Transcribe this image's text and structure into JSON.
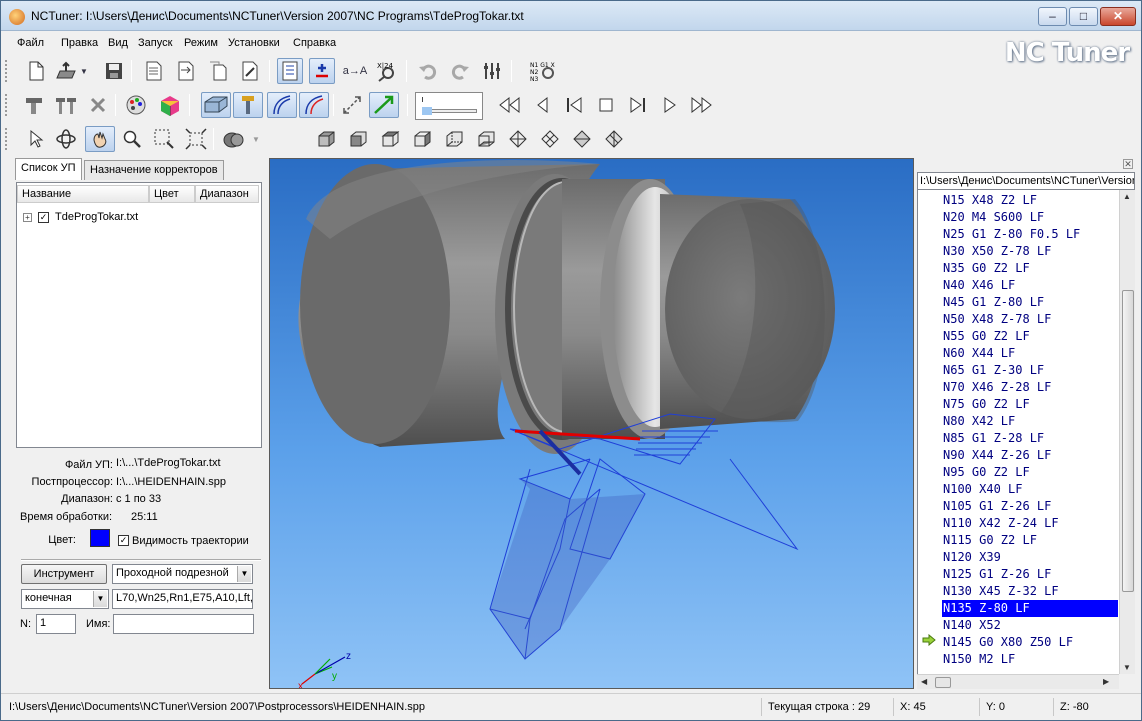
{
  "window": {
    "title": "NCTuner: I:\\Users\\Денис\\Documents\\NCTuner\\Version 2007\\NC Programs\\TdeProgTokar.txt",
    "min_glyph": "–",
    "max_glyph": "□",
    "close_glyph": "✕"
  },
  "menu": [
    "Файл",
    "Правка",
    "Вид",
    "Запуск",
    "Режим",
    "Установки",
    "Справка"
  ],
  "logo": "NC Tuner",
  "left_panel": {
    "tabs": [
      "Список УП",
      "Назначение корректоров"
    ],
    "columns": [
      "Название",
      "Цвет",
      "Диапазон"
    ],
    "program_name": "TdeProgTokar.txt",
    "program_checked": "✓",
    "info": {
      "file_label": "Файл УП:",
      "file_value": "I:\\...\\TdeProgTokar.txt",
      "pp_label": "Постпроцессор:",
      "pp_value": "I:\\...\\HEIDENHAIN.spp",
      "range_label": "Диапазон:",
      "range_value": "с 1  по 33",
      "time_label": "Время обработки:",
      "time_value": "25:11",
      "color_label": "Цвет:",
      "visibility_label": "Видимость траектории",
      "visibility_checked": "✓"
    },
    "tool_button": "Инструмент",
    "tool_combo": "Проходной подрезной",
    "mode_combo": "конечная",
    "tool_params": "L70,Wn25,Rn1,E75,A10,Lft,",
    "n_label": "N:",
    "n_value": "1",
    "name_label": "Имя:",
    "name_value": ""
  },
  "viewport": {
    "axes": {
      "x": "x",
      "y": "y",
      "z": "z"
    }
  },
  "code_panel": {
    "path": "I:\\Users\\Денис\\Documents\\NCTuner\\Version",
    "lines": [
      "N15 X48 Z2 LF",
      "N20 M4 S600 LF",
      "N25 G1 Z-80 F0.5 LF",
      "N30 X50 Z-78 LF",
      "N35 G0 Z2 LF",
      "N40 X46 LF",
      "N45 G1 Z-80 LF",
      "N50 X48 Z-78 LF",
      "N55 G0 Z2 LF",
      "N60 X44 LF",
      "N65 G1 Z-30 LF",
      "N70 X46 Z-28 LF",
      "N75 G0 Z2 LF",
      "N80 X42 LF",
      "N85 G1 Z-28 LF",
      "N90 X44 Z-26 LF",
      "N95 G0 Z2 LF",
      "N100 X40 LF",
      "N105 G1 Z-26 LF",
      "N110 X42 Z-24 LF",
      "N115 G0 Z2 LF",
      "N120 X39",
      "N125 G1 Z-26 LF",
      "N130 X45 Z-32 LF",
      "N135 Z-80 LF",
      "N140 X52",
      "N145 G0 X80 Z50 LF",
      "N150 M2 LF"
    ],
    "current_index": 24
  },
  "status": {
    "path": "I:\\Users\\Денис\\Documents\\NCTuner\\Version 2007\\Postprocessors\\HEIDENHAIN.spp",
    "current_line": "Текущая строка : 29",
    "x": "X: 45",
    "y": "Y: 0",
    "z": "Z: -80"
  },
  "colors": {
    "accent_blue": "#0000ff",
    "code_text": "#000080",
    "viewport_top": "#2a6dc4",
    "viewport_bottom": "#8fc3f6",
    "path_red": "#e00000"
  },
  "toolbar_icons": {
    "row1": [
      "new-file-icon",
      "open-icon",
      "save-icon",
      "report-icon",
      "export-icon",
      "copy-icon",
      "edit-program-icon",
      "numbering-icon",
      "plus-minus-icon",
      "replace-icon",
      "find-replace-icon",
      "undo-icon",
      "redo-icon",
      "settings-sliders-icon",
      "nc-inspect-icon"
    ],
    "row2": [
      "tool-icon",
      "tool-set-icon",
      "delete-icon",
      "palette-icon",
      "material-icon",
      "stock-icon",
      "fixture-icon",
      "trajectory-icon",
      "trajectory2-icon",
      "fit-arrows-icon",
      "path-arrow-icon",
      "speed-slider",
      "rewind-icon",
      "step-back-icon",
      "to-start-icon",
      "stop-icon",
      "to-end-icon",
      "play-icon",
      "fast-forward-icon"
    ],
    "row3": [
      "pointer-icon",
      "rotate-icon",
      "pan-icon",
      "zoom-icon",
      "zoom-window-icon",
      "zoom-fit-icon",
      "shading-icon",
      "view-iso-icon",
      "view-front-icon",
      "view-top-icon",
      "view-side-icon",
      "view-back-icon",
      "view-wire1-icon",
      "view-wire2-icon",
      "view-wire3-icon",
      "view-wire4-icon"
    ]
  }
}
